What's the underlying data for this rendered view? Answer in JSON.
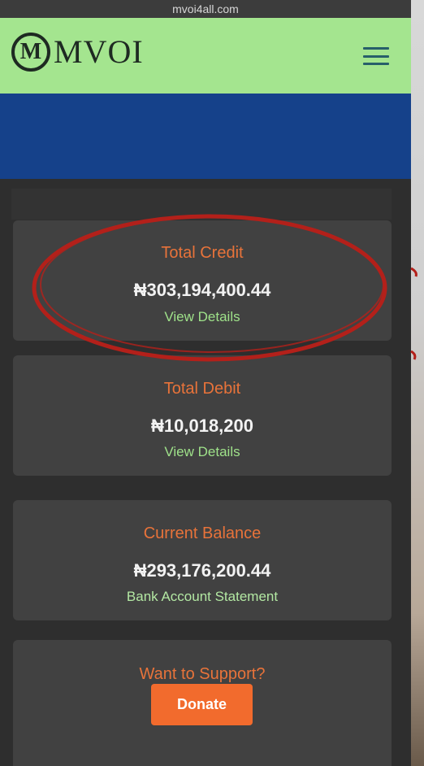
{
  "browser": {
    "url": "mvoi4all.com"
  },
  "header": {
    "logo_mark": "M",
    "logo_text": "MVOI"
  },
  "cards": [
    {
      "title": "Total Credit",
      "amount": "₦303,194,400.44",
      "link": "View Details"
    },
    {
      "title": "Total Debit",
      "amount": "₦10,018,200",
      "link": "View Details"
    },
    {
      "title": "Current Balance",
      "amount": "₦293,176,200.44",
      "link": "Bank Account Statement"
    }
  ],
  "support": {
    "title": "Want to Support?",
    "button": "Donate"
  },
  "colors": {
    "header_bg": "#a4e58f",
    "banner_bg": "#15418a",
    "accent_orange": "#e8733a",
    "link_green": "#9fe28a",
    "card_bg": "#414141",
    "annotation_red": "#b3201a"
  },
  "icons": {
    "menu": "hamburger-menu-icon"
  }
}
